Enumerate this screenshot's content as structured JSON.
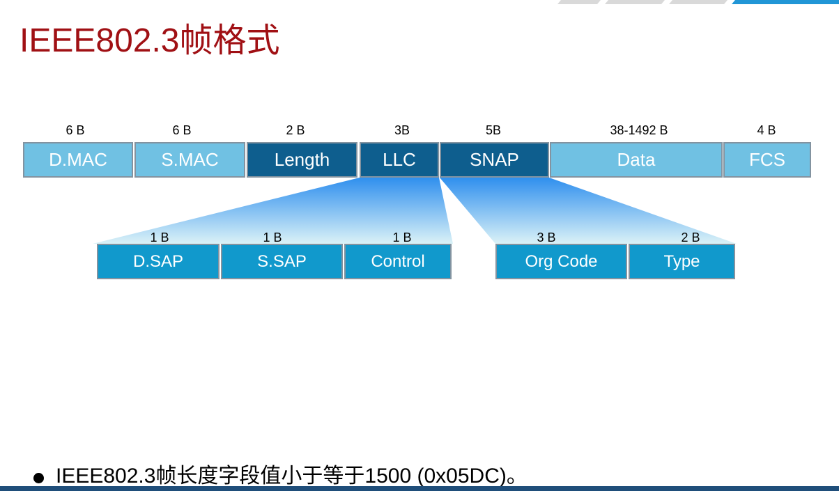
{
  "slide": {
    "title": "IEEE802.3帧格式",
    "bullet_text": "IEEE802.3帧长度字段值小于等于1500 (0x05DC)。"
  },
  "frame": {
    "fields": [
      {
        "label": "D.MAC",
        "size": "6 B",
        "color": "#70C1E3"
      },
      {
        "label": "S.MAC",
        "size": "6 B",
        "color": "#70C1E3"
      },
      {
        "label": "Length",
        "size": "2 B",
        "color": "#0E5E8E"
      },
      {
        "label": "LLC",
        "size": "3B",
        "color": "#0E5E8E"
      },
      {
        "label": "SNAP",
        "size": "5B",
        "color": "#0E5E8E"
      },
      {
        "label": "Data",
        "size": "38-1492 B",
        "color": "#70C1E3"
      },
      {
        "label": "FCS",
        "size": "4 B",
        "color": "#70C1E3"
      }
    ]
  },
  "llc": {
    "fields": [
      {
        "label": "D.SAP",
        "size": "1 B",
        "color": "#1199CC"
      },
      {
        "label": "S.SAP",
        "size": "1 B",
        "color": "#1199CC"
      },
      {
        "label": "Control",
        "size": "1 B",
        "color": "#1199CC"
      }
    ]
  },
  "snap": {
    "fields": [
      {
        "label": "Org Code",
        "size": "3 B",
        "color": "#1199CC"
      },
      {
        "label": "Type",
        "size": "2 B",
        "color": "#1199CC"
      }
    ]
  },
  "colors": {
    "title": "#A01014",
    "box_border": "#8393A0",
    "fan_top": "#2F8FEE",
    "fan_bottom": "#DBF2F7",
    "stripe_gray": "#D9D9D9",
    "stripe_blue": "#2196D6",
    "bottom_bar": "#1F4E7A"
  }
}
